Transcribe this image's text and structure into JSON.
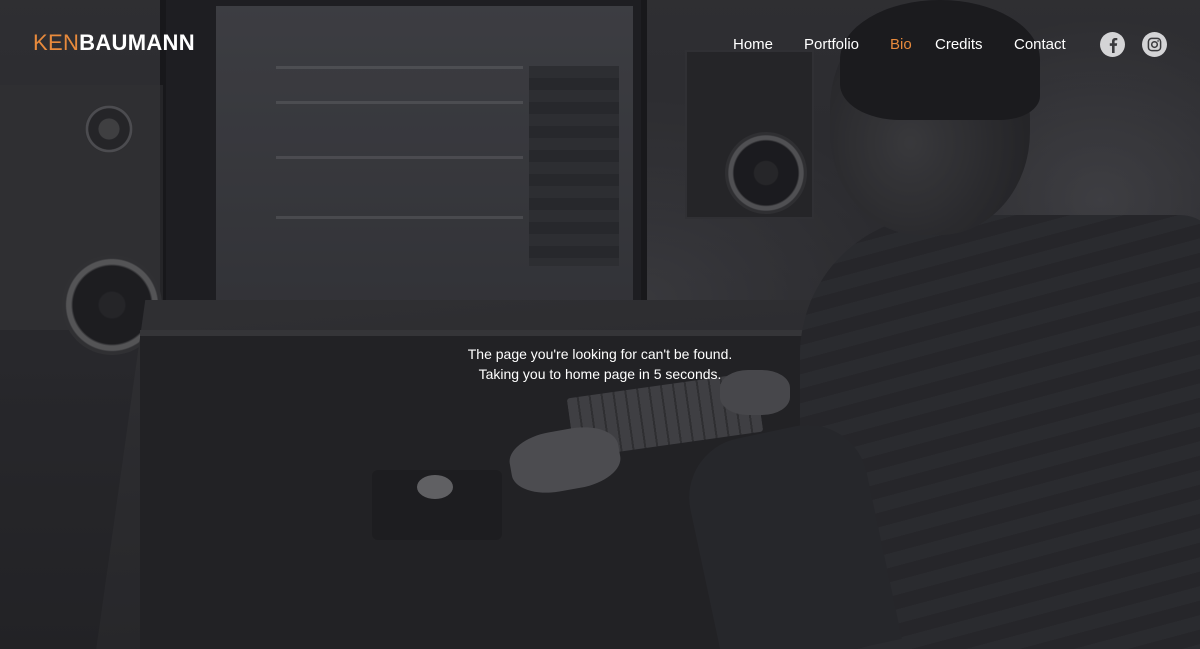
{
  "header": {
    "logo": {
      "first": "KEN",
      "last": "BAUMANN"
    },
    "nav": [
      {
        "label": "Home",
        "active": false
      },
      {
        "label": "Portfolio",
        "active": false
      },
      {
        "label": "Bio",
        "active": true
      },
      {
        "label": "Credits",
        "active": false
      },
      {
        "label": "Contact",
        "active": false
      }
    ],
    "social": [
      {
        "icon": "facebook-icon"
      },
      {
        "icon": "instagram-icon"
      }
    ]
  },
  "main": {
    "message_line1": "The page you're looking for can't be found.",
    "message_line2": "Taking you to home page in 5 seconds."
  },
  "colors": {
    "accent": "#e88a3c",
    "text": "#ffffff",
    "social_bg": "#d4d4d6"
  }
}
